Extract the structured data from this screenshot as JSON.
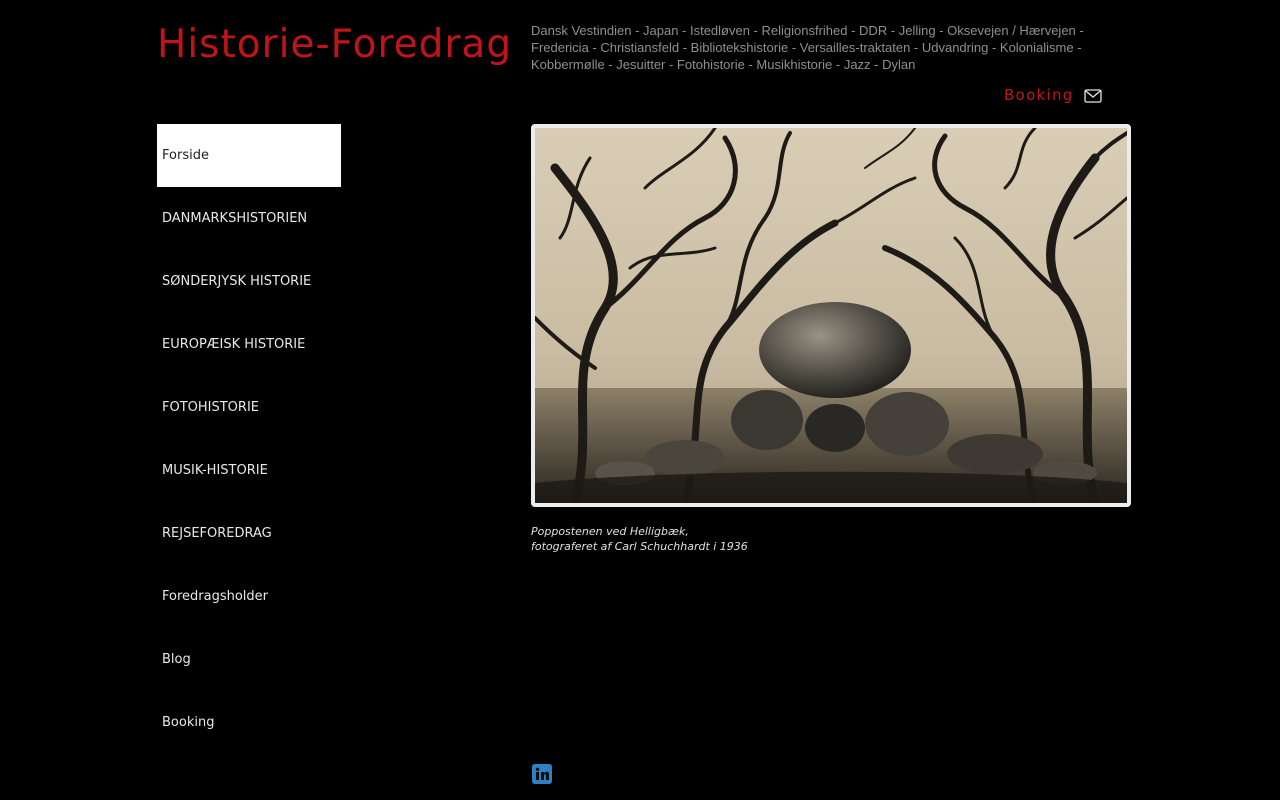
{
  "colors": {
    "background": "#000000",
    "accent": "#c0141b",
    "nav_active_background": "#ffffff",
    "linkedin": "#2f7fc7"
  },
  "header": {
    "site_title": "Historie-Foredrag",
    "topics": "Dansk Vestindien - Japan - Istedløven - Religionsfrihed - DDR - Jelling - Oksevejen / Hærvejen - Fredericia - Christiansfeld - Bibliotekshistorie - Versailles-traktaten - Udvandring - Kolonialisme  - Kobbermølle - Jesuitter - Fotohistorie - Musikhistorie - Jazz - Dylan",
    "booking_label": "Booking",
    "booking_icon": "mail-icon"
  },
  "sidebar": {
    "items": [
      {
        "label": "Forside",
        "active": true
      },
      {
        "label": "DANMARKSHISTORIEN",
        "active": false
      },
      {
        "label": "SØNDERJYSK HISTORIE",
        "active": false
      },
      {
        "label": "EUROPÆISK HISTORIE",
        "active": false
      },
      {
        "label": "FOTOHISTORIE",
        "active": false
      },
      {
        "label": "MUSIK-HISTORIE",
        "active": false
      },
      {
        "label": "REJSEFOREDRAG",
        "active": false
      },
      {
        "label": "Foredragsholder",
        "active": false
      },
      {
        "label": "Blog",
        "active": false
      },
      {
        "label": "Booking",
        "active": false
      }
    ]
  },
  "main": {
    "caption_line1": "Poppostenen ved Helligbæk,",
    "caption_line2": "fotograferet af Carl Schuchhardt i 1936",
    "social_icon": "linkedin-icon"
  }
}
